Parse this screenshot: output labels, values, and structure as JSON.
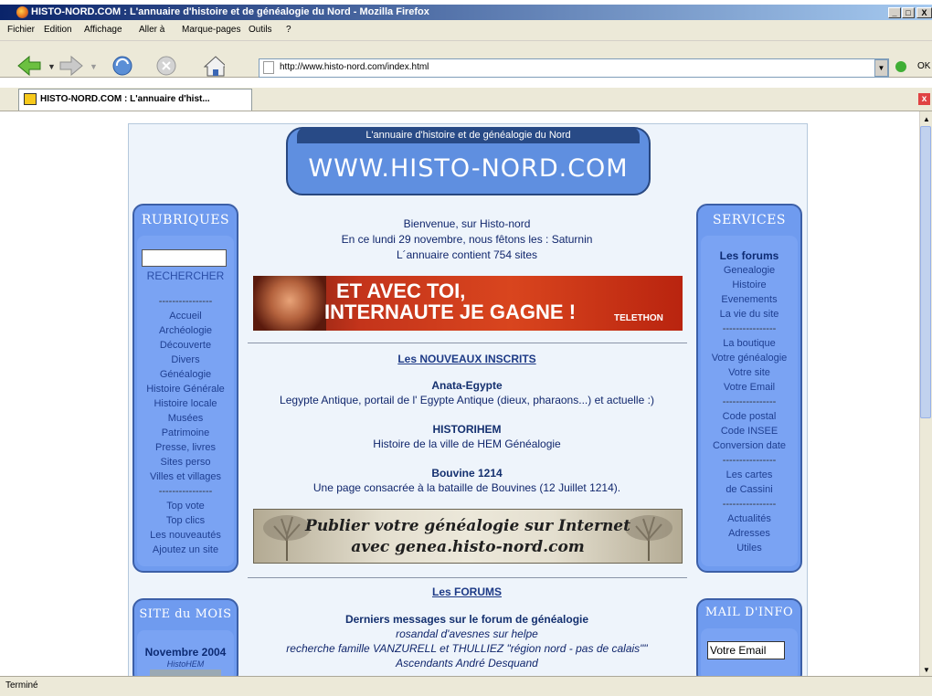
{
  "window": {
    "title": "HISTO-NORD.COM : L'annuaire d'histoire et de généalogie du Nord - Mozilla Firefox"
  },
  "menu": [
    "Fichier",
    "Edition",
    "Affichage",
    "Aller à",
    "Marque-pages",
    "Outils",
    "?"
  ],
  "address": {
    "url": "http://www.histo-nord.com/index.html",
    "go_label": "OK"
  },
  "tab": {
    "label": "HISTO-NORD.COM : L'annuaire d'hist..."
  },
  "status": {
    "text": "Terminé"
  },
  "banner": {
    "top": "L'annuaire d'histoire et de généalogie du Nord",
    "main": "WWW.HISTO-NORD.COM"
  },
  "left": {
    "title": "RUBRIQUES",
    "search_button": "RECHERCHER",
    "sep": "----------------",
    "items": [
      "Accueil",
      "Archéologie",
      "Découverte",
      "Divers",
      "Généalogie",
      "Histoire Générale",
      "Histoire locale",
      "Musées",
      "Patrimoine",
      "Presse, livres",
      "Sites perso",
      "Villes et villages"
    ],
    "items2": [
      "Top vote",
      "Top clics",
      "Les nouveautés",
      "Ajoutez un site"
    ]
  },
  "site_mois": {
    "title": "SITE du MOIS",
    "label": "Novembre 2004",
    "site": "HistoHEM"
  },
  "right": {
    "title": "SERVICES",
    "forums": "Les forums",
    "group1": [
      "Genealogie",
      "Histoire",
      "Evenements",
      "La vie du site"
    ],
    "sep": "----------------",
    "group2": [
      "La boutique",
      "Votre généalogie",
      "Votre site",
      "Votre Email"
    ],
    "group3": [
      "Code postal",
      "Code INSEE",
      "Conversion date"
    ],
    "group4": [
      "Les cartes",
      "de Cassini"
    ],
    "group5": [
      "Actualités",
      "Adresses",
      "Utiles"
    ]
  },
  "mail": {
    "title": "MAIL D'INFO",
    "placeholder": "Votre Email"
  },
  "welcome": {
    "line1": "Bienvenue, sur Histo-nord",
    "line2": "En ce lundi 29 novembre, nous fêtons les : Saturnin",
    "line3": "L´annuaire contient 754 sites"
  },
  "telethon": {
    "line1": "ET AVEC TOI,",
    "line2": "INTERNAUTE JE GAGNE !",
    "brand": "TELETHON"
  },
  "inscrits": {
    "heading": "Les NOUVEAUX INSCRITS",
    "entries": [
      {
        "name": "Anata-Egypte",
        "desc": "Legypte Antique, portail de l' Egypte Antique (dieux, pharaons...) et actuelle :)"
      },
      {
        "name": "HISTORIHEM",
        "desc": "Histoire de la ville de HEM Généalogie"
      },
      {
        "name": "Bouvine 1214",
        "desc": "Une page consacrée à la bataille de Bouvines (12 Juillet 1214)."
      }
    ]
  },
  "publish": {
    "line1": "Publier votre généalogie sur Internet",
    "line2": "avec genea.histo-nord.com"
  },
  "forums": {
    "heading": "Les FORUMS",
    "sub": "Derniers messages sur le forum de généalogie",
    "msgs": [
      "rosandal d'avesnes sur helpe",
      "recherche famille VANZURELL et THULLIEZ \"région nord - pas de calais\"\"",
      "Ascendants André Desquand"
    ]
  }
}
